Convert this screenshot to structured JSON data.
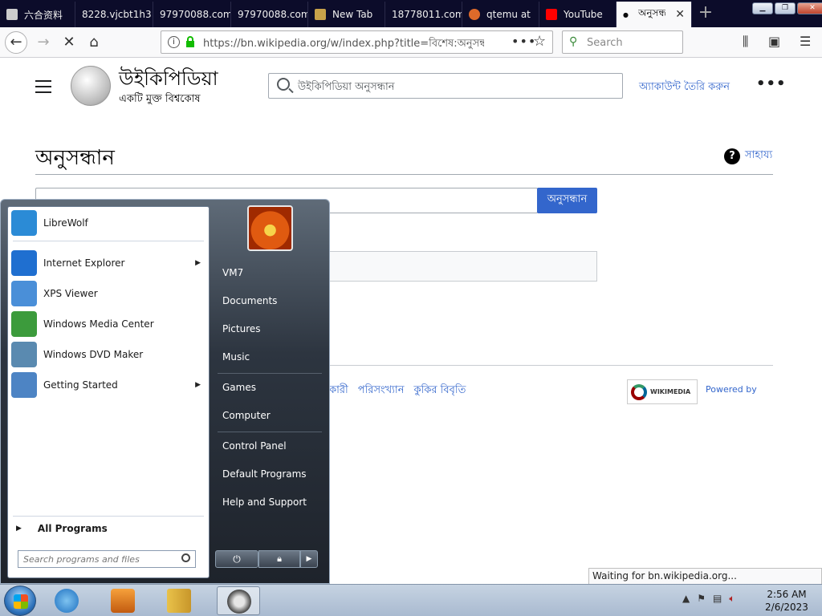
{
  "browser": {
    "tabs": [
      {
        "label": "六合资料"
      },
      {
        "label": "8228.vjcbt1h3"
      },
      {
        "label": "97970088.com"
      },
      {
        "label": "97970088.com"
      },
      {
        "label": "New Tab"
      },
      {
        "label": "18778011.com"
      },
      {
        "label": "qtemu at"
      },
      {
        "label": "YouTube"
      },
      {
        "label": "অনুসন্ধা"
      }
    ],
    "url": "https://bn.wikipedia.org/w/index.php?title=বিশেষ:অনুসন্ধান",
    "search_placeholder": "Search"
  },
  "wiki": {
    "title": "উইকিপিডিয়া",
    "tagline": "একটি মুক্ত বিশ্বকোষ",
    "search_placeholder": "উইকিপিডিয়া অনুসন্ধান",
    "create_account": "অ্যাকাউন্ট তৈরি করুন",
    "heading": "অনুসন্ধান",
    "help": "সাহায্য",
    "search_button": "অনুসন্ধান",
    "footer_links": [
      "কারী",
      "পরিসংখ্যান",
      "কুকির বিবৃতি"
    ],
    "wikimedia_badge": "WIKIMEDIA",
    "powered_by": "Powered by"
  },
  "start_menu": {
    "pinned": [
      {
        "label": "LibreWolf",
        "color": "#2b8bd6"
      },
      {
        "label": "Internet Explorer",
        "color": "#1f6fd0"
      },
      {
        "label": "XPS Viewer",
        "color": "#4a8fd8"
      },
      {
        "label": "Windows Media Center",
        "color": "#3c9b3c"
      },
      {
        "label": "Windows DVD Maker",
        "color": "#5a8ab0"
      },
      {
        "label": "Getting Started",
        "color": "#4d84c4"
      }
    ],
    "all_programs": "All Programs",
    "search_placeholder": "Search programs and files",
    "right": {
      "user": "VM7",
      "documents": "Documents",
      "pictures": "Pictures",
      "music": "Music",
      "games": "Games",
      "computer": "Computer",
      "control_panel": "Control Panel",
      "default_programs": "Default Programs",
      "help": "Help and Support"
    }
  },
  "status": "Waiting for bn.wikipedia.org...",
  "taskbar": {
    "time": "2:56 AM",
    "date": "2/6/2023"
  }
}
